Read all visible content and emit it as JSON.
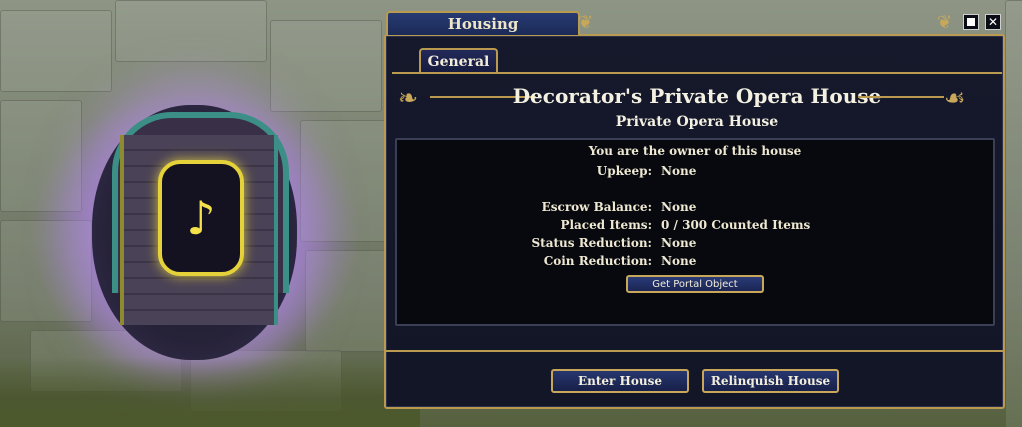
{
  "window": {
    "title": "Housing",
    "tabs": [
      {
        "label": "General",
        "active": true
      }
    ],
    "controls": {
      "minimize_icon": "minimize-icon",
      "close_label": "✕"
    }
  },
  "house": {
    "name": "Decorator's Private Opera House",
    "type": "Private Opera House",
    "owner_message": "You are the owner of this house"
  },
  "details": [
    {
      "label": "Upkeep:",
      "value": "None"
    },
    {
      "label": "Escrow Balance:",
      "value": "None"
    },
    {
      "label": "Placed Items:",
      "value": "0 / 300 Counted Items"
    },
    {
      "label": "Status Reduction:",
      "value": "None"
    },
    {
      "label": "Coin Reduction:",
      "value": "None"
    }
  ],
  "buttons": {
    "get_portal": "Get Portal Object",
    "enter": "Enter House",
    "relinquish": "Relinquish House"
  },
  "colors": {
    "accent_gold": "#b99a4f",
    "window_bg": "#15192b",
    "button_blue": "#27376e"
  }
}
